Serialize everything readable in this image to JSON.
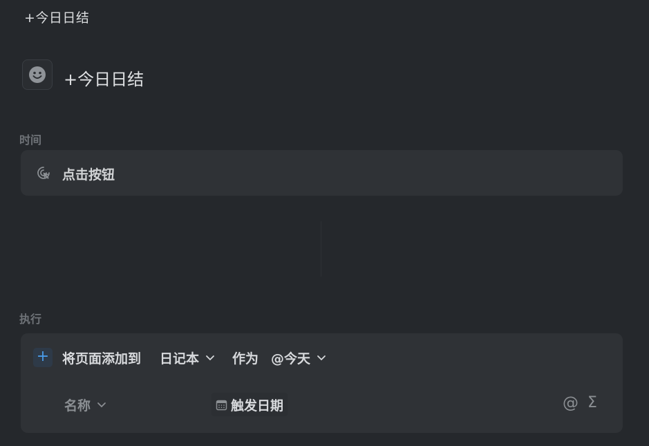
{
  "page": {
    "top_title": "+今日日结",
    "title": "+今日日结",
    "emoji_icon": "smiley-face-icon"
  },
  "trigger_section": {
    "label": "时间",
    "trigger_label": "点击按钮",
    "icon": "cursor-click-icon"
  },
  "action_section": {
    "label": "执行",
    "action_text": "将页面添加到",
    "target_db": "日记本",
    "as_text": "作为",
    "as_value": "@今天",
    "property_name": "名称",
    "property_value": "触发日期",
    "property_value_icon": "calendar-icon",
    "mention_icon": "@",
    "formula_icon": "Σ"
  },
  "colors": {
    "background": "#25282c",
    "card": "#2f3236",
    "accent": "#4a9be8",
    "muted": "#6f7378"
  }
}
